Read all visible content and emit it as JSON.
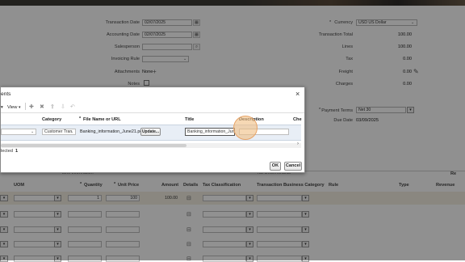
{
  "header_form": {
    "left": [
      {
        "label": "Transaction Date",
        "value": "02/07/2025",
        "icon": "calendar-icon"
      },
      {
        "label": "Accounting Date",
        "value": "02/07/2025",
        "icon": "calendar-icon"
      },
      {
        "label": "Salesperson",
        "value": "",
        "icon": "search-icon"
      },
      {
        "label": "Invoicing Rule",
        "value": "",
        "icon": "chevron-down-icon"
      },
      {
        "label": "Attachments",
        "value": "None"
      },
      {
        "label": "Notes",
        "value": ""
      }
    ],
    "right": [
      {
        "label": "Currency",
        "value": "USD US Dollar",
        "required": "*"
      },
      {
        "label": "Transaction Total",
        "value": "100.00"
      },
      {
        "label": "Lines",
        "value": "100.00"
      },
      {
        "label": "Tax",
        "value": "0.00"
      },
      {
        "label": "Freight",
        "value": "0.00"
      },
      {
        "label": "Charges",
        "value": "0.00"
      },
      {
        "label": "Payment Terms",
        "value": "Net 30",
        "required": "*"
      },
      {
        "label": "Due Date",
        "value": "03/09/2025"
      }
    ]
  },
  "lines_section": {
    "group_labels": [
      "Line Information",
      "Tax Determinants"
    ],
    "right_cut_label": "Re",
    "columns": [
      "UOM",
      "Quantity",
      "Unit Price",
      "Amount",
      "Details",
      "Tax Classification",
      "Transaction Business Category",
      "Rule",
      "Type",
      "Revenue"
    ],
    "first_row": {
      "quantity": "1",
      "unit_price": "100",
      "amount": "100.00"
    }
  },
  "dialog": {
    "title": "ents",
    "close_glyph": "×",
    "toolbar": {
      "view_label": "View"
    },
    "columns": {
      "category": "Category",
      "file": "File Name or URL",
      "title": "Title",
      "description": "Description",
      "checked": "Che",
      "required": "*"
    },
    "row": {
      "category": "Customer Tran",
      "file_name": "Banking_information_June21.pdf",
      "update_label": "Update...",
      "title": "Banking_information_June",
      "description": ""
    },
    "selected_label": "lected",
    "selected_count": "1",
    "ok_label": "OK",
    "cancel_label": "Cancel"
  },
  "colors": {
    "overlay": "#000000",
    "focus_ring": "#e8a467",
    "selected_row": "#f2eee2"
  }
}
